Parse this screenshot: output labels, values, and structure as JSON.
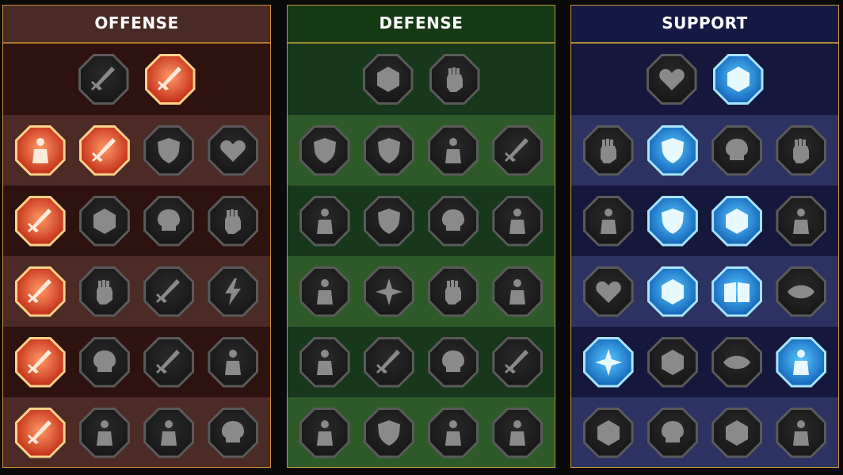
{
  "trees": [
    {
      "id": "offense",
      "title": "OFFENSE",
      "tiers": [
        [
          {
            "icon": "crossed-swords-icon",
            "active": false
          },
          {
            "icon": "blade-slash-icon",
            "active": true
          }
        ],
        [
          {
            "icon": "horned-demon-icon",
            "active": true
          },
          {
            "icon": "slashing-sword-icon",
            "active": true
          },
          {
            "icon": "shield-arrow-icon",
            "active": false
          },
          {
            "icon": "heart-burst-icon",
            "active": false
          }
        ],
        [
          {
            "icon": "arrow-pierced-warrior-icon",
            "active": true
          },
          {
            "icon": "fanged-jaw-icon",
            "active": false
          },
          {
            "icon": "skull-slash-icon",
            "active": false
          },
          {
            "icon": "raised-fist-slash-icon",
            "active": false
          }
        ],
        [
          {
            "icon": "bleeding-dagger-icon",
            "active": true
          },
          {
            "icon": "hammer-fist-icon",
            "active": false
          },
          {
            "icon": "cleaving-axe-icon",
            "active": false
          },
          {
            "icon": "lightning-chain-icon",
            "active": false
          }
        ],
        [
          {
            "icon": "burst-arrows-icon",
            "active": true
          },
          {
            "icon": "skull-mask-icon",
            "active": false
          },
          {
            "icon": "circle-sword-icon",
            "active": false
          },
          {
            "icon": "strong-warrior-icon",
            "active": false
          }
        ],
        [
          {
            "icon": "sparkling-sword-icon",
            "active": true
          },
          {
            "icon": "knight-helm-icon",
            "active": false
          },
          {
            "icon": "horned-brute-icon",
            "active": false
          },
          {
            "icon": "helmed-skull-warrior-icon",
            "active": false
          }
        ]
      ]
    },
    {
      "id": "defense",
      "title": "DEFENSE",
      "tiers": [
        [
          {
            "icon": "armor-plates-icon",
            "active": false
          },
          {
            "icon": "fist-ring-icon",
            "active": false
          }
        ],
        [
          {
            "icon": "chevron-shield-icon",
            "active": false
          },
          {
            "icon": "heart-shield-icon",
            "active": false
          },
          {
            "icon": "brawler-icon",
            "active": false
          },
          {
            "icon": "deflect-blade-icon",
            "active": false
          }
        ],
        [
          {
            "icon": "bowman-icon",
            "active": false
          },
          {
            "icon": "knight-shield-icon",
            "active": false
          },
          {
            "icon": "skull-heart-icon",
            "active": false
          },
          {
            "icon": "hooded-figure-icon",
            "active": false
          }
        ],
        [
          {
            "icon": "rallying-crowd-icon",
            "active": false
          },
          {
            "icon": "hourglass-burst-icon",
            "active": false
          },
          {
            "icon": "open-hand-icon",
            "active": false
          },
          {
            "icon": "bull-head-icon",
            "active": false
          }
        ],
        [
          {
            "icon": "dashing-runner-icon",
            "active": false
          },
          {
            "icon": "triple-claw-icon",
            "active": false
          },
          {
            "icon": "spiked-skull-icon",
            "active": false
          },
          {
            "icon": "swirl-blade-icon",
            "active": false
          }
        ],
        [
          {
            "icon": "crowned-beast-icon",
            "active": false
          },
          {
            "icon": "winged-shield-icon",
            "active": false
          },
          {
            "icon": "bearded-warrior-icon",
            "active": false
          },
          {
            "icon": "flexing-giant-icon",
            "active": false
          }
        ]
      ]
    },
    {
      "id": "support",
      "title": "SUPPORT",
      "tiers": [
        [
          {
            "icon": "heart-plus-icon",
            "active": false
          },
          {
            "icon": "speed-gauge-icon",
            "active": true
          }
        ],
        [
          {
            "icon": "praying-hands-icon",
            "active": false
          },
          {
            "icon": "guardian-shield-icon",
            "active": true
          },
          {
            "icon": "flaming-skull-icon",
            "active": false
          },
          {
            "icon": "pointing-hand-icon",
            "active": false
          }
        ],
        [
          {
            "icon": "blessed-figure-icon",
            "active": false
          },
          {
            "icon": "lightning-shield-icon",
            "active": true
          },
          {
            "icon": "shattered-ground-icon",
            "active": true
          },
          {
            "icon": "shadow-figures-icon",
            "active": false
          }
        ],
        [
          {
            "icon": "chained-heart-icon",
            "active": false
          },
          {
            "icon": "fireball-icon",
            "active": true
          },
          {
            "icon": "open-book-icon",
            "active": true
          },
          {
            "icon": "angry-eyes-icon",
            "active": false
          }
        ],
        [
          {
            "icon": "compass-star-icon",
            "active": true
          },
          {
            "icon": "swift-boot-icon",
            "active": false
          },
          {
            "icon": "all-seeing-eye-icon",
            "active": false
          },
          {
            "icon": "voodoo-doll-icon",
            "active": true
          }
        ],
        [
          {
            "icon": "potion-flask-icon",
            "active": false
          },
          {
            "icon": "winged-skull-icon",
            "active": false
          },
          {
            "icon": "fortress-gate-icon",
            "active": false
          },
          {
            "icon": "eagle-head-icon",
            "active": false
          }
        ]
      ]
    }
  ]
}
